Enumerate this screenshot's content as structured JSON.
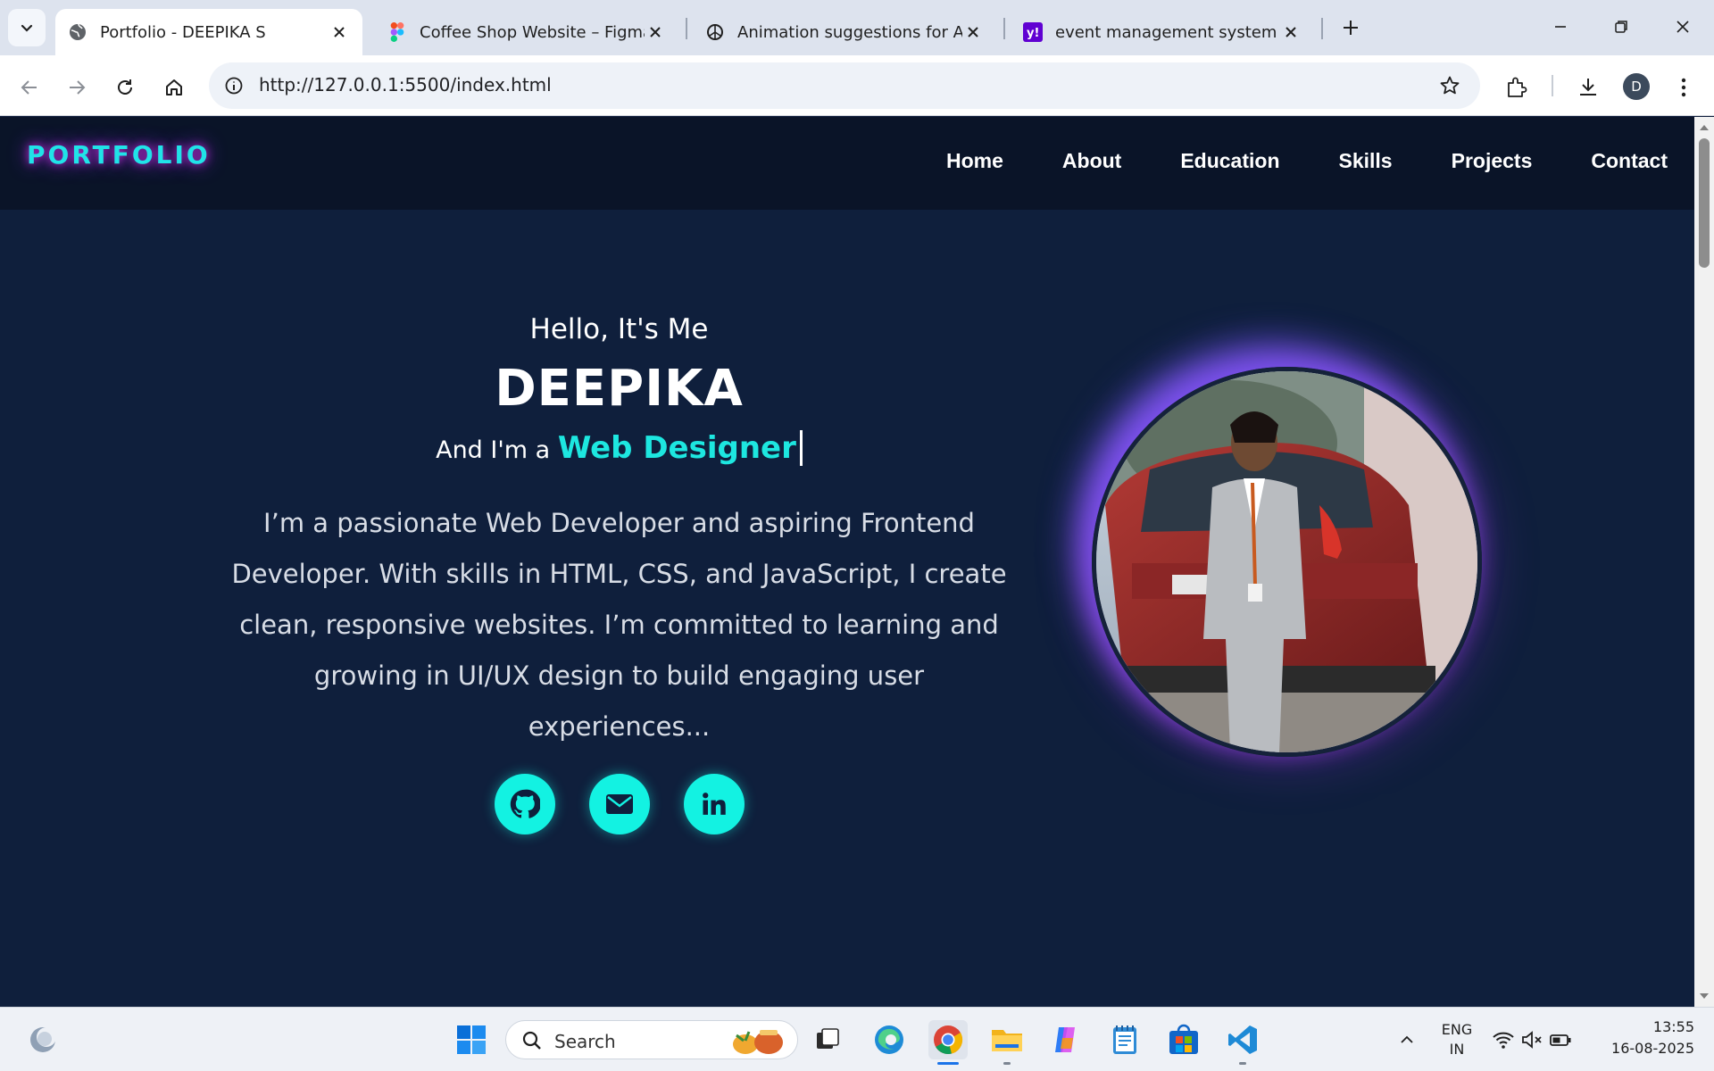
{
  "browser": {
    "tabs": [
      {
        "title": "Portfolio - DEEPIKA S",
        "favicon": "globe-icon",
        "active": true
      },
      {
        "title": "Coffee Shop Website – Figma",
        "favicon": "figma-icon",
        "active": false
      },
      {
        "title": "Animation suggestions for Abo",
        "favicon": "chatgpt-icon",
        "active": false
      },
      {
        "title": "event management system - Ya",
        "favicon": "yahoo-icon",
        "active": false
      }
    ],
    "url": "http://127.0.0.1:5500/index.html",
    "profile_initial": "D",
    "colors": {
      "tabstrip": "#dde3ee",
      "omnibox": "#eef2f8"
    }
  },
  "page": {
    "logo": "PORTFOLIO",
    "nav": [
      "Home",
      "About",
      "Education",
      "Skills",
      "Projects",
      "Contact"
    ],
    "hero": {
      "greeting": "Hello, It's Me",
      "name": "DEEPIKA",
      "role_prefix": "And I'm a",
      "role_typed": "Web Designer",
      "bio": "I’m a passionate Web Developer and aspiring Frontend Developer. With skills in HTML, CSS, and JavaScript, I create clean, responsive websites. I’m committed to learning and growing in UI/UX design to build engaging user experiences...",
      "socials": [
        "github-icon",
        "envelope-icon",
        "linkedin-icon"
      ]
    },
    "colors": {
      "background": "#0f1f3c",
      "navbar": "#0a1428",
      "accent": "#13f2e2",
      "glow": "#c62bd6"
    }
  },
  "taskbar": {
    "search_label": "Search",
    "tray": {
      "lang_top": "ENG",
      "lang_bottom": "IN"
    },
    "time": "13:55",
    "date": "16-08-2025",
    "apps": [
      "windows-start-icon",
      "task-view-icon",
      "edge-icon",
      "chrome-icon",
      "file-explorer-icon",
      "copilot-icon",
      "notepad-icon",
      "ms-store-icon",
      "vscode-icon"
    ]
  }
}
